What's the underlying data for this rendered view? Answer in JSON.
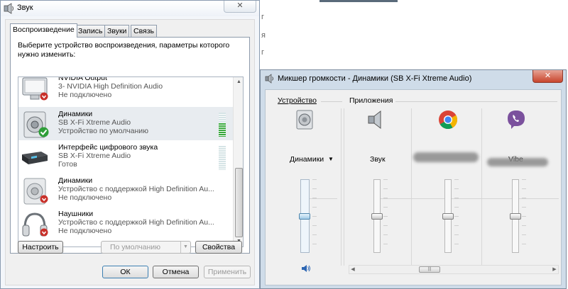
{
  "sound_dialog": {
    "title": "Звук",
    "close_glyph": "✕",
    "tabs": [
      {
        "label": "Воспроизведение",
        "active": true
      },
      {
        "label": "Запись",
        "active": false
      },
      {
        "label": "Звуки",
        "active": false
      },
      {
        "label": "Связь",
        "active": false
      }
    ],
    "instruction": "Выберите устройство воспроизведения, параметры которого нужно изменить:",
    "devices": [
      {
        "name": "NVIDIA Output",
        "sub": "3- NVIDIA High Definition Audio",
        "status": "Не подключено",
        "icon": "monitor-speaker-icon",
        "badge": "red-down-badge-icon",
        "level": null
      },
      {
        "name": "Динамики",
        "sub": "SB X-Fi Xtreme Audio",
        "status": "Устройство по умолчанию",
        "icon": "speaker-icon",
        "badge": "green-check-badge-icon",
        "level": 0.55
      },
      {
        "name": "Интерфейс цифрового звука",
        "sub": "SB X-Fi Xtreme Audio",
        "status": "Готов",
        "icon": "digital-audio-icon",
        "badge": null,
        "level": 0.0
      },
      {
        "name": "Динамики",
        "sub": "Устройство с поддержкой High Definition Au...",
        "status": "Не подключено",
        "icon": "speaker-icon",
        "badge": "red-down-badge-icon",
        "level": null
      },
      {
        "name": "Наушники",
        "sub": "Устройство с поддержкой High Definition Au...",
        "status": "Не подключено",
        "icon": "headphones-icon",
        "badge": "red-down-badge-icon",
        "level": null
      }
    ],
    "buttons": {
      "configure": "Настроить",
      "set_default": "По умолчанию",
      "properties": "Свойства",
      "ok": "ОК",
      "cancel": "Отмена",
      "apply": "Применить"
    }
  },
  "mixer": {
    "title": "Микшер громкости - Динамики (SB X-Fi Xtreme Audio)",
    "close_glyph": "✕",
    "device_section": "Устройство",
    "apps_section": "Приложения",
    "device_channel": {
      "label": "Динамики",
      "volume": 0.5
    },
    "app_channels": [
      {
        "label": "Звук",
        "volume": 0.5,
        "icon": "speaker-icon"
      },
      {
        "label": "",
        "volume": 0.5,
        "icon": "chrome-icon"
      },
      {
        "label": "Vibe",
        "volume": 0.5,
        "icon": "viber-icon"
      }
    ]
  },
  "colors": {
    "accent": "#3a7bd5",
    "level_green": "#38a83c",
    "close_red": "#c8452c",
    "viber_purple": "#7b519d"
  }
}
